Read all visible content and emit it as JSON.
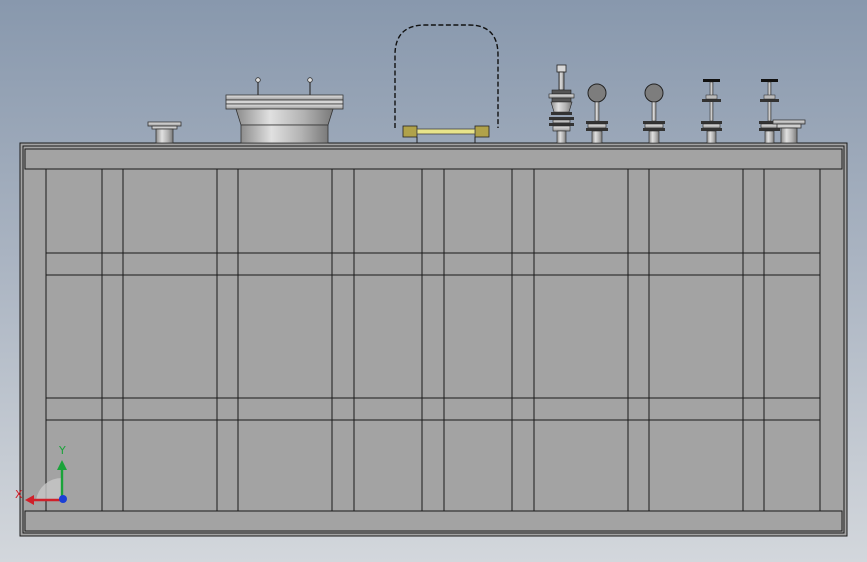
{
  "colors": {
    "background_top": "#8898ad",
    "background_bottom": "#d3d7dc",
    "panel_fill": "#a3a3a3",
    "edge": "#1a1a1a",
    "fitting_metal": "#b9b9b9",
    "gauge_fill": "#7d7d7d",
    "sight_glass": "#e8e48a",
    "flange_accent": "#b0a24a",
    "axis_x": "#d0202a",
    "axis_y": "#1aa33a",
    "axis_z": "#1a3fd6"
  },
  "triad": {
    "x_label": "X",
    "y_label": "Y"
  },
  "icons": {
    "triad": "coordinate-triad-icon",
    "manhole": "manhole-flange-icon",
    "nozzle": "nozzle-icon",
    "gauge": "pressure-gauge-icon",
    "valve": "valve-icon",
    "sight": "level-sight-gauge-icon"
  }
}
